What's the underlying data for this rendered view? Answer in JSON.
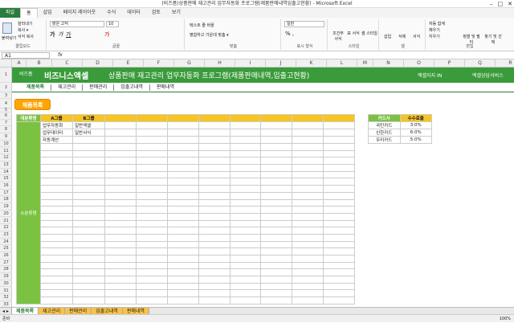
{
  "window": {
    "title": "(비즈폼)상품판매 재고관리 업무자동화 프로그램(제품판매내역입출고현황) - Microsoft Excel",
    "controls": [
      "–",
      "□",
      "✕"
    ]
  },
  "ribbon_tabs": [
    "파일",
    "홈",
    "삽입",
    "페이지 레이아웃",
    "수식",
    "데이터",
    "검토",
    "보기"
  ],
  "ribbon": {
    "paste": "붙여넣기",
    "cut": "잘라내기",
    "copy": "복사 ▾",
    "format_painter": "서식 복사",
    "font_name": "맑은 고딕",
    "font_size": "10",
    "wrap": "텍스트 줄 바꿈",
    "merge": "병합하고 가운데 맞춤 ▾",
    "number_format": "일반",
    "cond_format": "조건부 서식",
    "table_format": "표 서식",
    "cell_style": "셀 스타일",
    "insert": "삽입",
    "delete": "삭제",
    "format": "서식",
    "autosum": "자동 합계",
    "fill": "채우기",
    "clear": "지우기",
    "sort": "정렬 및 필터",
    "find": "찾기 및 선택",
    "groups": [
      "클립보드",
      "글꼴",
      "맞춤",
      "표시 형식",
      "스타일",
      "셀",
      "편집"
    ]
  },
  "formula_bar": {
    "name_box": "A1",
    "fx": "fx"
  },
  "columns": [
    "A",
    "B",
    "C",
    "D",
    "E",
    "F",
    "G",
    "H",
    "I",
    "J",
    "K",
    "L",
    "M",
    "N",
    "O",
    "P",
    "Q",
    "R"
  ],
  "rows": [
    "1",
    "2",
    "3",
    "4",
    "5",
    "6",
    "7",
    "8",
    "9",
    "10",
    "11",
    "12",
    "13",
    "14",
    "15",
    "16",
    "17",
    "18",
    "19",
    "20",
    "21",
    "22",
    "23",
    "24",
    "25",
    "26",
    "27",
    "28",
    "29",
    "30",
    "31",
    "32",
    "33"
  ],
  "banner": {
    "logo": "비즈폼",
    "brand": "비즈니스엑셀",
    "title": "상품판매 재고관리 업무자동화 프로그램(제품판매내역,입출고현황)",
    "link1": "엑셀자지 IN",
    "link2": "엑셀상담서비스"
  },
  "nav": [
    "제품목록",
    "재고관리",
    "판매관리",
    "입출고내역",
    "판매내역"
  ],
  "product_button": "제품목록",
  "main_table": {
    "headers": [
      "대분류명",
      "A그룹",
      "B그룹"
    ],
    "rows": [
      [
        "업무자동화",
        "일반엑셀"
      ],
      [
        "업무데이터",
        "일반서식"
      ],
      [
        "자동계산",
        ""
      ]
    ],
    "side_label": "소분류명"
  },
  "card_table": {
    "headers": [
      "카드사",
      "수수료율"
    ],
    "rows": [
      [
        "국민카드",
        "3.0%"
      ],
      [
        "신한카드",
        "6.0%"
      ],
      [
        "우리카드",
        "5.0%"
      ]
    ]
  },
  "sheet_tabs": [
    "제품목록",
    "재고관리",
    "판매관리",
    "입출고내역",
    "판매내역"
  ],
  "status": {
    "ready": "준비",
    "zoom": "100%"
  }
}
